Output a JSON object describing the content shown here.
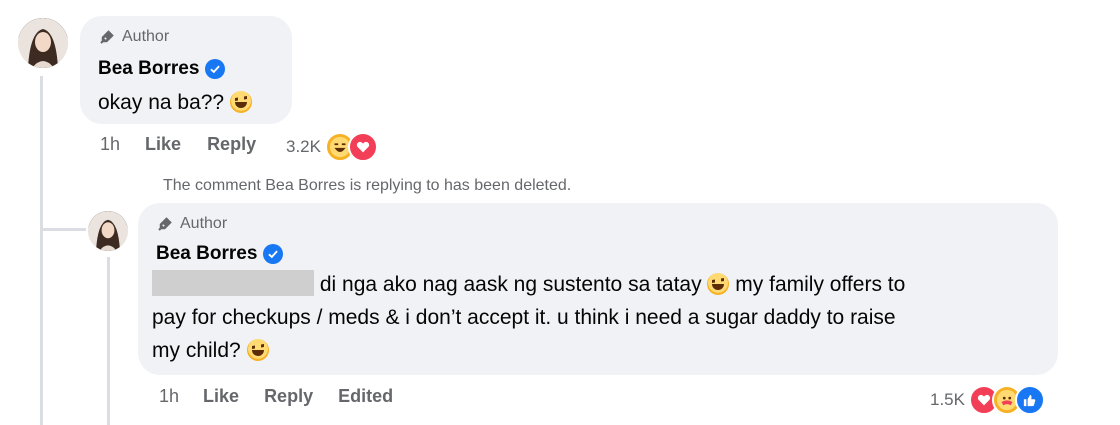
{
  "comment1": {
    "author_badge": "Author",
    "name": "Bea Borres",
    "text": "okay na ba??",
    "time": "1h",
    "like": "Like",
    "reply": "Reply",
    "reaction_count": "3.2K",
    "reaction_icons": [
      "haha-icon",
      "love-icon"
    ]
  },
  "deleted_note": "The comment Bea Borres is replying to has been deleted.",
  "comment2": {
    "author_badge": "Author",
    "name": "Bea Borres",
    "text_line1": "di nga ako nag aask ng sustento sa tatay",
    "text_line1b": "my family offers to",
    "text_line2": "pay for checkups / meds & i don’t accept it. u think i need a sugar daddy to raise",
    "text_line3": "my child?",
    "time": "1h",
    "like": "Like",
    "reply": "Reply",
    "edited": "Edited",
    "reaction_count": "1.5K",
    "reaction_icons": [
      "love-icon",
      "care-icon",
      "like-icon"
    ]
  },
  "colors": {
    "bubble": "#f0f2f5",
    "meta_text": "#65676b",
    "verified": "#1877f2",
    "love": "#f33e58"
  }
}
